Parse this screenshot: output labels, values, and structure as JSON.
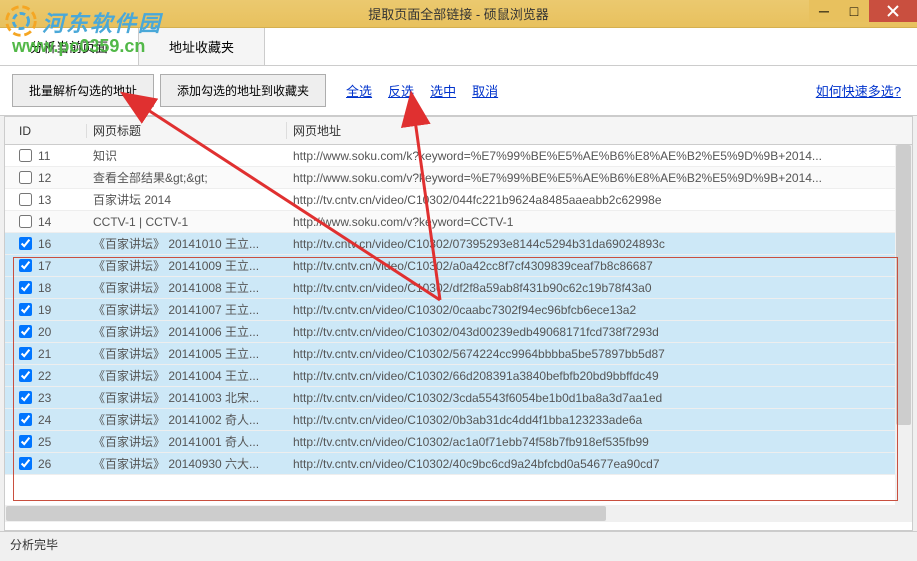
{
  "window": {
    "title": "提取页面全部链接 - 硕鼠浏览器"
  },
  "watermark": {
    "text1": "河东软件园",
    "text2": "www.pc0359.cn"
  },
  "tabs": {
    "tab1": "分析当前页面",
    "tab2": "地址收藏夹"
  },
  "toolbar": {
    "btn_parse": "批量解析勾选的地址",
    "btn_favorite": "添加勾选的地址到收藏夹",
    "link_select_all": "全选",
    "link_invert": "反选",
    "link_select": "选中",
    "link_cancel": "取消",
    "link_help": "如何快速多选?"
  },
  "grid": {
    "header_id": "ID",
    "header_title": "网页标题",
    "header_url": "网页地址",
    "rows": [
      {
        "id": "11",
        "checked": false,
        "selected": false,
        "title": "知识",
        "url": "http://www.soku.com/k?keyword=%E7%99%BE%E5%AE%B6%E8%AE%B2%E5%9D%9B+2014..."
      },
      {
        "id": "12",
        "checked": false,
        "selected": false,
        "title": "查看全部结果&gt;&gt;",
        "url": "http://www.soku.com/v?keyword=%E7%99%BE%E5%AE%B6%E8%AE%B2%E5%9D%9B+2014..."
      },
      {
        "id": "13",
        "checked": false,
        "selected": false,
        "title": "百家讲坛 2014",
        "url": "http://tv.cntv.cn/video/C10302/044fc221b9624a8485aaeabb2c62998e"
      },
      {
        "id": "14",
        "checked": false,
        "selected": false,
        "title": "CCTV-1 | CCTV-1",
        "url": "http://www.soku.com/v?keyword=CCTV-1"
      },
      {
        "id": "16",
        "checked": true,
        "selected": true,
        "title": "《百家讲坛》 20141010 王立...",
        "url": "http://tv.cntv.cn/video/C10302/07395293e8144c5294b31da69024893c"
      },
      {
        "id": "17",
        "checked": true,
        "selected": true,
        "title": "《百家讲坛》 20141009 王立...",
        "url": "http://tv.cntv.cn/video/C10302/a0a42cc8f7cf4309839ceaf7b8c86687"
      },
      {
        "id": "18",
        "checked": true,
        "selected": true,
        "title": "《百家讲坛》 20141008 王立...",
        "url": "http://tv.cntv.cn/video/C10302/df2f8a59ab8f431b90c62c19b78f43a0"
      },
      {
        "id": "19",
        "checked": true,
        "selected": true,
        "title": "《百家讲坛》 20141007 王立...",
        "url": "http://tv.cntv.cn/video/C10302/0caabc7302f94ec96bfcb6ece13a2"
      },
      {
        "id": "20",
        "checked": true,
        "selected": true,
        "title": "《百家讲坛》 20141006 王立...",
        "url": "http://tv.cntv.cn/video/C10302/043d00239edb49068171fcd738f7293d"
      },
      {
        "id": "21",
        "checked": true,
        "selected": true,
        "title": "《百家讲坛》 20141005 王立...",
        "url": "http://tv.cntv.cn/video/C10302/5674224cc9964bbbba5be57897bb5d87"
      },
      {
        "id": "22",
        "checked": true,
        "selected": true,
        "title": "《百家讲坛》 20141004 王立...",
        "url": "http://tv.cntv.cn/video/C10302/66d208391a3840befbfb20bd9bbffdc49"
      },
      {
        "id": "23",
        "checked": true,
        "selected": true,
        "title": "《百家讲坛》 20141003 北宋...",
        "url": "http://tv.cntv.cn/video/C10302/3cda5543f6054be1b0d1ba8a3d7aa1ed"
      },
      {
        "id": "24",
        "checked": true,
        "selected": true,
        "title": "《百家讲坛》 20141002 奇人...",
        "url": "http://tv.cntv.cn/video/C10302/0b3ab31dc4dd4f1bba123233ade6a"
      },
      {
        "id": "25",
        "checked": true,
        "selected": true,
        "title": "《百家讲坛》 20141001 奇人...",
        "url": "http://tv.cntv.cn/video/C10302/ac1a0f71ebb74f58b7fb918ef535fb99"
      },
      {
        "id": "26",
        "checked": true,
        "selected": true,
        "title": "《百家讲坛》 20140930 六大...",
        "url": "http://tv.cntv.cn/video/C10302/40c9bc6cd9a24bfcbd0a54677ea90cd7"
      }
    ]
  },
  "statusbar": {
    "text": "分析完毕"
  }
}
